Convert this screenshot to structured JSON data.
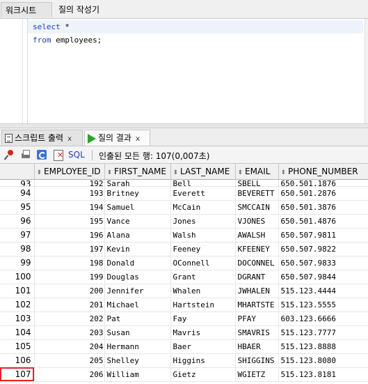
{
  "worksheet_tabs": {
    "worksheet": "워크시트",
    "query_builder": "질의 작성기"
  },
  "editor": {
    "line1": {
      "keyword": "select",
      "rest": " *"
    },
    "line2": {
      "keyword": "from",
      "rest": " employees;"
    }
  },
  "result_tabs": {
    "script_output": {
      "label": "스크립트 출력",
      "close": "x",
      "icon": "document-icon"
    },
    "query_result": {
      "label": "질의 결과",
      "close": "x",
      "icon": "run-play-icon"
    }
  },
  "toolbar": {
    "icons": [
      "pin-icon",
      "print-icon",
      "refresh-icon",
      "cancel-icon"
    ],
    "sql_label": "SQL",
    "fetched_text": "인출된 모든 행: 107(0,007초)"
  },
  "grid": {
    "columns": [
      "EMPLOYEE_ID",
      "FIRST_NAME",
      "LAST_NAME",
      "EMAIL",
      "PHONE_NUMBER"
    ],
    "partial_row": {
      "rownum": "93",
      "employee_id": "192",
      "first_name": "Sarah",
      "last_name": "Bell",
      "email": "SBELL",
      "phone": "650.501.1876"
    },
    "rows": [
      {
        "rownum": "94",
        "employee_id": "193",
        "first_name": "Britney",
        "last_name": "Everett",
        "email": "BEVERETT",
        "phone": "650.501.2876"
      },
      {
        "rownum": "95",
        "employee_id": "194",
        "first_name": "Samuel",
        "last_name": "McCain",
        "email": "SMCCAIN",
        "phone": "650.501.3876"
      },
      {
        "rownum": "96",
        "employee_id": "195",
        "first_name": "Vance",
        "last_name": "Jones",
        "email": "VJONES",
        "phone": "650.501.4876"
      },
      {
        "rownum": "97",
        "employee_id": "196",
        "first_name": "Alana",
        "last_name": "Walsh",
        "email": "AWALSH",
        "phone": "650.507.9811"
      },
      {
        "rownum": "98",
        "employee_id": "197",
        "first_name": "Kevin",
        "last_name": "Feeney",
        "email": "KFEENEY",
        "phone": "650.507.9822"
      },
      {
        "rownum": "99",
        "employee_id": "198",
        "first_name": "Donald",
        "last_name": "OConnell",
        "email": "DOCONNEL",
        "phone": "650.507.9833"
      },
      {
        "rownum": "100",
        "employee_id": "199",
        "first_name": "Douglas",
        "last_name": "Grant",
        "email": "DGRANT",
        "phone": "650.507.9844"
      },
      {
        "rownum": "101",
        "employee_id": "200",
        "first_name": "Jennifer",
        "last_name": "Whalen",
        "email": "JWHALEN",
        "phone": "515.123.4444"
      },
      {
        "rownum": "102",
        "employee_id": "201",
        "first_name": "Michael",
        "last_name": "Hartstein",
        "email": "MHARTSTE",
        "phone": "515.123.5555"
      },
      {
        "rownum": "103",
        "employee_id": "202",
        "first_name": "Pat",
        "last_name": "Fay",
        "email": "PFAY",
        "phone": "603.123.6666"
      },
      {
        "rownum": "104",
        "employee_id": "203",
        "first_name": "Susan",
        "last_name": "Mavris",
        "email": "SMAVRIS",
        "phone": "515.123.7777"
      },
      {
        "rownum": "105",
        "employee_id": "204",
        "first_name": "Hermann",
        "last_name": "Baer",
        "email": "HBAER",
        "phone": "515.123.8888"
      },
      {
        "rownum": "106",
        "employee_id": "205",
        "first_name": "Shelley",
        "last_name": "Higgins",
        "email": "SHIGGINS",
        "phone": "515.123.8080"
      },
      {
        "rownum": "107",
        "employee_id": "206",
        "first_name": "William",
        "last_name": "Gietz",
        "email": "WGIETZ",
        "phone": "515.123.8181"
      }
    ],
    "selected_rownum": "107",
    "highlight_color": "#e0242c"
  },
  "colors": {
    "keyword": "#1c3fb8",
    "run_green": "#2aa52a"
  }
}
